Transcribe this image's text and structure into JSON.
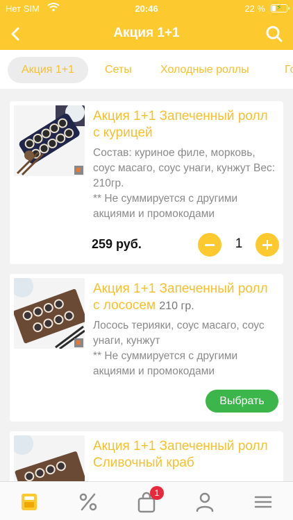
{
  "status_bar": {
    "carrier": "Нет SIM",
    "time": "20:46",
    "battery": "22 %"
  },
  "header": {
    "title": "Акция 1+1",
    "back_icon": "chevron-left-icon",
    "search_icon": "search-icon"
  },
  "tabs": [
    {
      "label": "Акция 1+1",
      "active": true
    },
    {
      "label": "Сеты",
      "active": false
    },
    {
      "label": "Холодные роллы",
      "active": false
    },
    {
      "label": "Го",
      "active": false
    }
  ],
  "products": [
    {
      "name": "Акция 1+1 Запеченный ролл с курицей",
      "weight": "",
      "description": "Состав: куриное филе, морковь, соус масаго, соус унаги, кунжут Вес: 210гр.",
      "note": "** Не суммируется с другими акциями и промокодами",
      "price": "259 руб.",
      "quantity": "1"
    },
    {
      "name": "Акция 1+1 Запеченный ролл с лососем",
      "weight": "210 гр.",
      "description": "Лосось терияки, соус масаго, соус унаги, кунжут",
      "note": " ** Не суммируется с другими акциями и промокодами",
      "button": "Выбрать"
    },
    {
      "name": "Акция 1+1 Запеченный ролл Сливочный краб"
    }
  ],
  "bottom_nav": {
    "items": [
      "menu-card-icon",
      "percent-icon",
      "bag-icon",
      "user-icon",
      "hamburger-icon"
    ],
    "cart_badge": "1"
  },
  "colors": {
    "accent": "#fcc92e",
    "green": "#3cb54a",
    "badge": "#e8283c"
  }
}
